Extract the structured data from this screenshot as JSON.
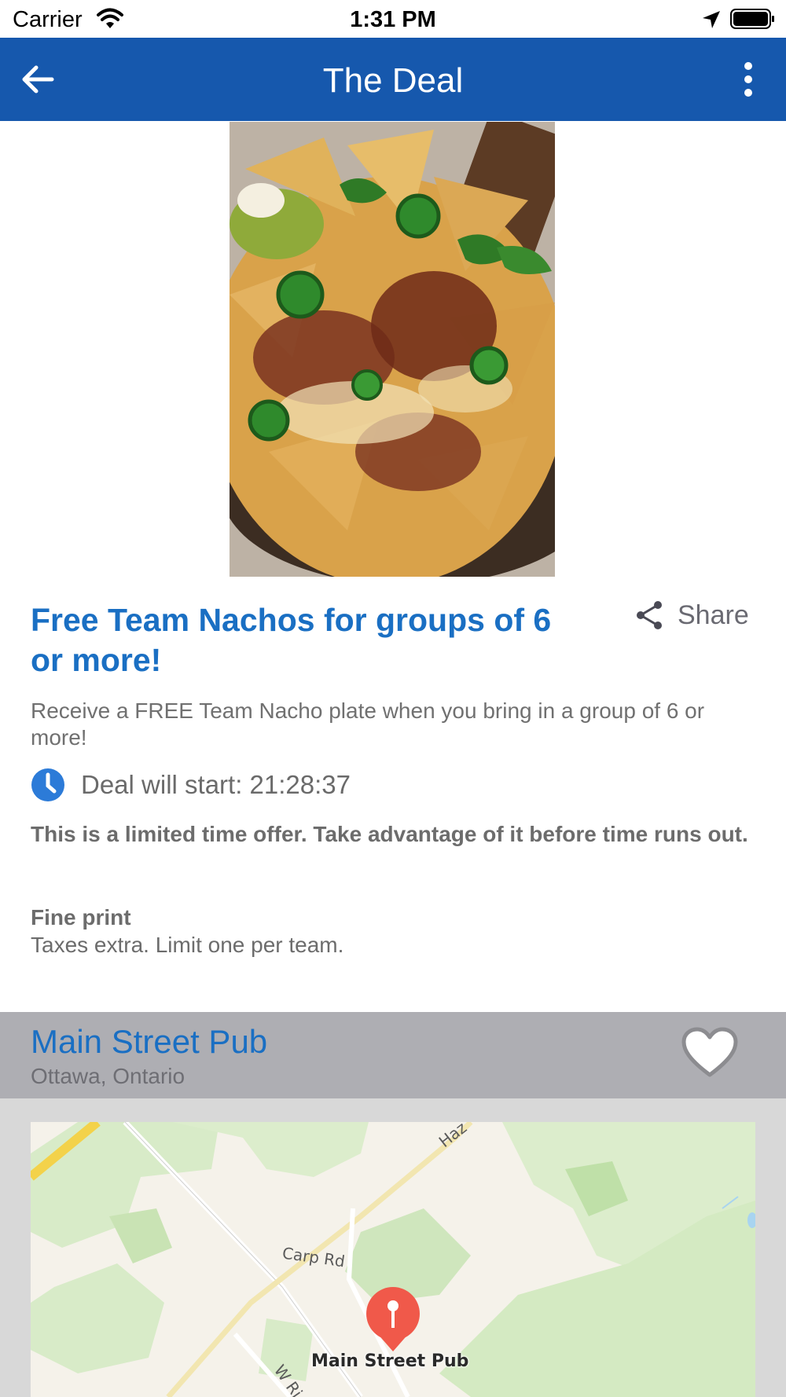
{
  "status_bar": {
    "carrier": "Carrier",
    "time": "1:31 PM"
  },
  "app_bar": {
    "title": "The Deal"
  },
  "deal": {
    "title": "Free Team Nachos for groups of 6 or more!",
    "share_label": "Share",
    "description": "Receive a FREE Team Nacho plate when you bring in a group of 6 or more!",
    "start_text": "Deal will start: 21:28:37",
    "limited_offer": "This is a limited time offer. Take advantage of it before time runs out.",
    "fine_print_label": "Fine print",
    "fine_print_text": "Taxes extra. Limit one per team."
  },
  "venue": {
    "name": "Main Street Pub",
    "location": "Ottawa, Ontario",
    "favorited": false
  },
  "map": {
    "roads": [
      "Carp Rd",
      "Haz",
      "W Ri"
    ],
    "pin_label": "Main Street Pub"
  },
  "colors": {
    "app_bar": "#1658ad",
    "accent_text": "#1a6fc3",
    "venue_bar": "#aeaeb3",
    "map_pin": "#f0594a"
  },
  "icons": [
    "wifi-icon",
    "location-arrow-icon",
    "battery-icon",
    "back-arrow-icon",
    "more-vert-icon",
    "share-icon",
    "clock-icon",
    "heart-icon",
    "map-pin-icon"
  ]
}
